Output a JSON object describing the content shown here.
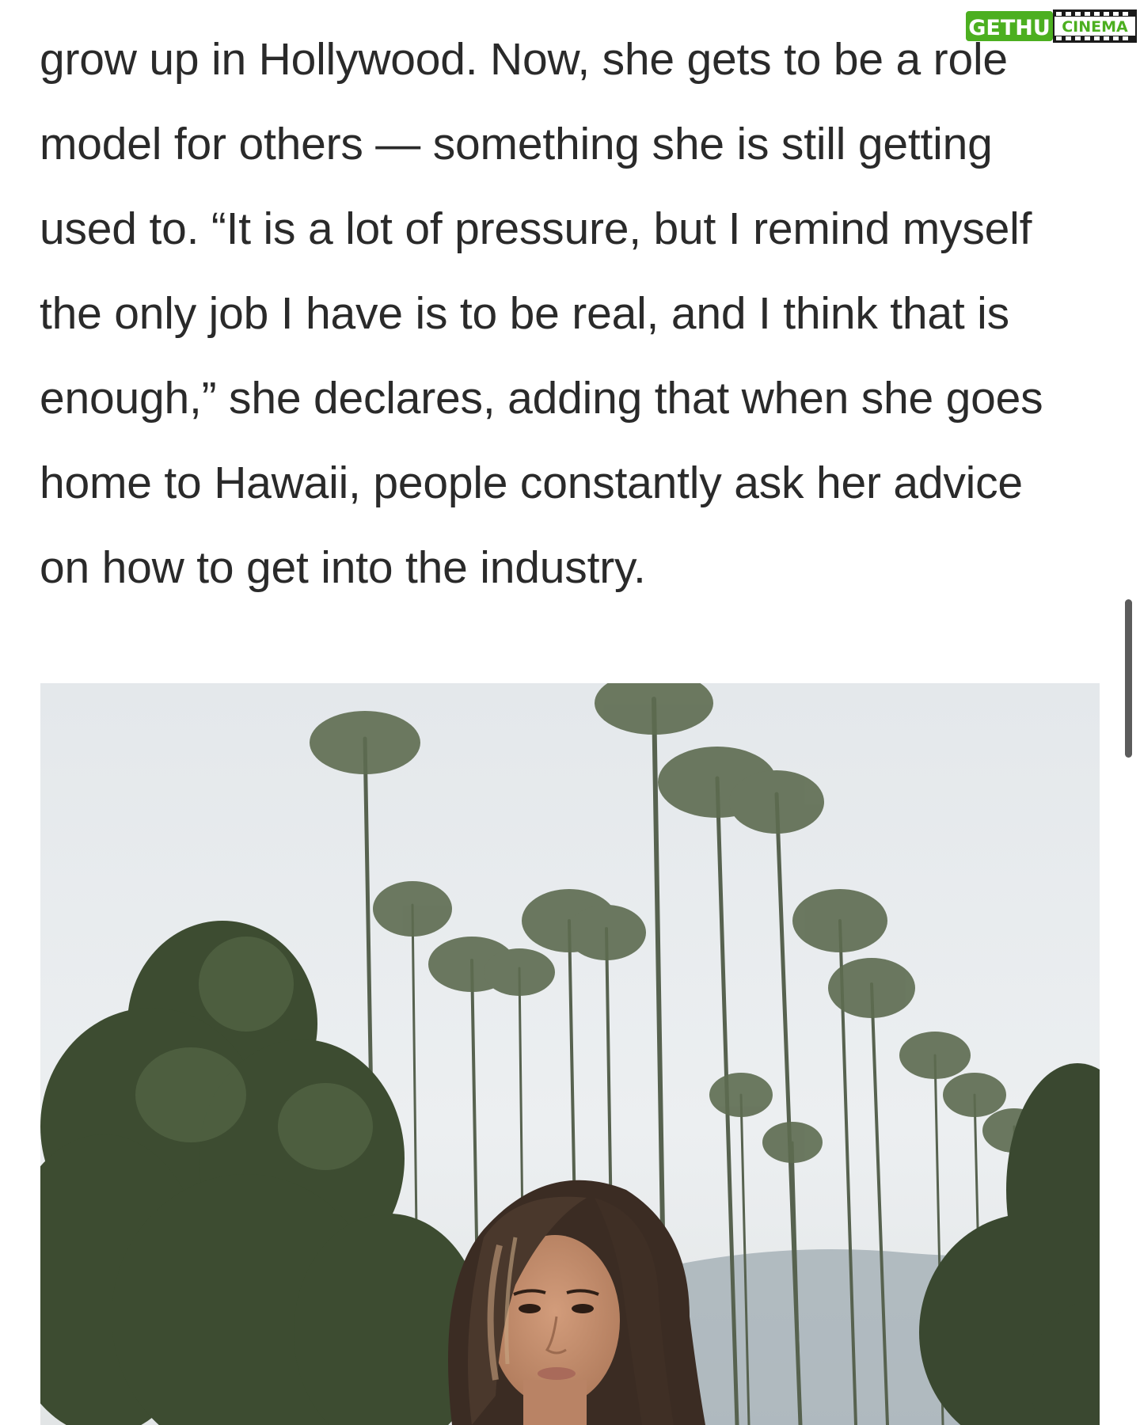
{
  "article": {
    "lines": [
      "grow up in Hollywood. Now, she gets to be a role",
      "model for others — something she is still getting",
      "used to. “It is a lot of pressure, but I remind myself",
      "the only job I have is to be real, and I think that is",
      "enough,” she declares, adding that when she goes",
      "home to Hawaii, people constantly ask her advice",
      "on how to get into the industry."
    ]
  },
  "watermark": {
    "part1": "GETHU",
    "part2": "CINEMA",
    "icon": "film-camera-icon",
    "color_primary": "#4caf20",
    "color_secondary": "#1a1a1a"
  },
  "photo": {
    "subject": "portrait-photo",
    "colors": {
      "sky": "#e8ecef",
      "palm_trunk": "#4d5a48",
      "palm_fronds": "#5f6e52",
      "trees": "#3b4a30",
      "hair": "#3a2b22",
      "skin": "#c48f6f"
    }
  },
  "scrollbar": {
    "color": "#5c5c5c"
  }
}
